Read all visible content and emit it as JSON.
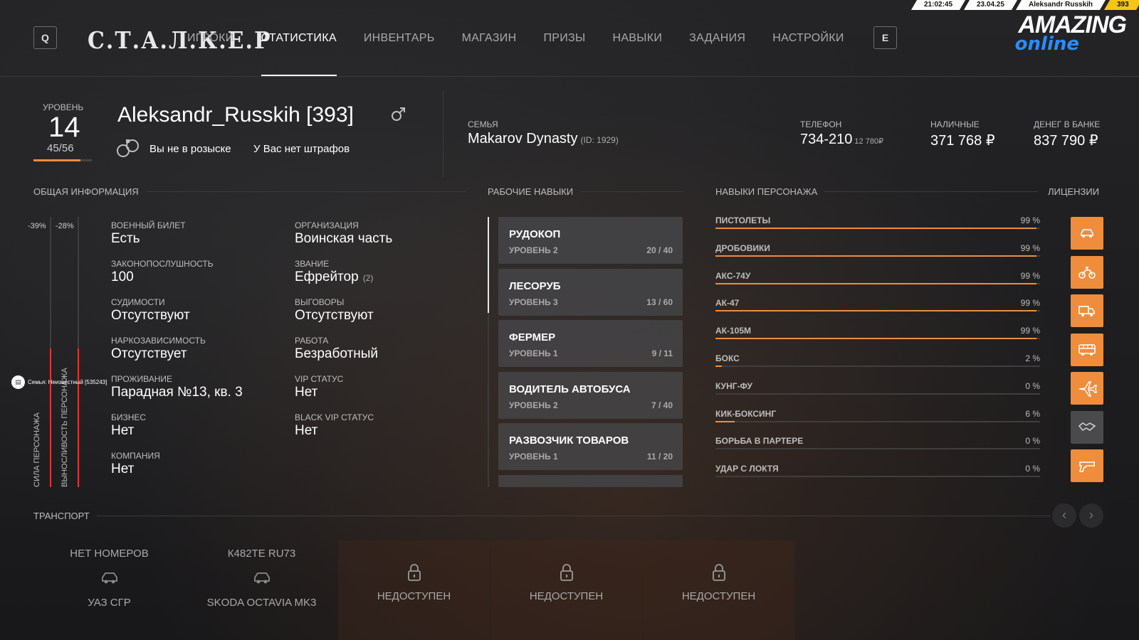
{
  "topbar": {
    "time": "21:02:45",
    "date": "23.04.25",
    "user": "Aleksandr Russkih",
    "id": "393"
  },
  "nav": {
    "left_key": "Q",
    "right_key": "E",
    "logo": "С.Т.А.Л.К.Е.Р",
    "items": [
      "ИГРОКИ",
      "СТАТИСТИКА",
      "ИНВЕНТАРЬ",
      "МАГАЗИН",
      "ПРИЗЫ",
      "НАВЫКИ",
      "ЗАДАНИЯ",
      "НАСТРОЙКИ"
    ],
    "active": "СТАТИСТИКА"
  },
  "brand": {
    "line1": "AMAZING",
    "line2": "online"
  },
  "player": {
    "level_label": "УРОВЕНЬ",
    "level": "14",
    "xp": "45/56",
    "xp_progress": 0.8,
    "name": "Aleksandr_Russkih [393]",
    "gender_icon": "male-icon",
    "wanted": "Вы не в розыске",
    "fines": "У Вас нет штрафов"
  },
  "family": {
    "label": "СЕМЬЯ",
    "name": "Makarov Dynasty",
    "id": "(ID: 1929)"
  },
  "stats": {
    "phone_label": "ТЕЛЕФОН",
    "phone": "734-210",
    "phone_balance": "12 780₽",
    "cash_label": "НАЛИЧНЫЕ",
    "cash": "371 768 ₽",
    "bank_label": "ДЕНЕГ В БАНКЕ",
    "bank": "837 790 ₽"
  },
  "sections": {
    "general": "ОБЩАЯ ИНФОРМАЦИЯ",
    "work": "РАБОЧИЕ НАВЫКИ",
    "character": "НАВЫКИ ПЕРСОНАЖА",
    "licenses": "ЛИЦЕНЗИИ",
    "transport": "ТРАНСПОРТ"
  },
  "gauges": {
    "strength_label": "СИЛА ПЕРСОНАЖА",
    "strength_pct": "-39%",
    "stamina_label": "ВЫНОСЛИВОСТЬ ПЕРСОНАЖА",
    "stamina_pct": "-28%"
  },
  "general_left": [
    {
      "label": "ВОЕННЫЙ БИЛЕТ",
      "value": "Есть"
    },
    {
      "label": "ЗАКОНОПОСЛУШНОСТЬ",
      "value": "100"
    },
    {
      "label": "СУДИМОСТИ",
      "value": "Отсутствуют"
    },
    {
      "label": "НАРКОЗАВИСИМОСТЬ",
      "value": "Отсутствует"
    },
    {
      "label": "ПРОЖИВАНИЕ",
      "value": "Парадная №13, кв. 3"
    },
    {
      "label": "БИЗНЕС",
      "value": "Нет"
    },
    {
      "label": "КОМПАНИЯ",
      "value": "Нет"
    }
  ],
  "general_right": [
    {
      "label": "ОРГАНИЗАЦИЯ",
      "value": "Воинская часть",
      "extra": ""
    },
    {
      "label": "ЗВАНИЕ",
      "value": "Ефрейтор",
      "extra": "(2)"
    },
    {
      "label": "ВЫГОВОРЫ",
      "value": "Отсутствуют",
      "extra": ""
    },
    {
      "label": "РАБОТА",
      "value": "Безработный",
      "extra": ""
    },
    {
      "label": "VIP СТАТУС",
      "value": "Нет",
      "extra": ""
    },
    {
      "label": "BLACK VIP СТАТУС",
      "value": "Нет",
      "extra": ""
    }
  ],
  "family_tag": {
    "icon": "family-icon",
    "text": "Семья: Неизвестный [535243]"
  },
  "work_skills": [
    {
      "name": "РУДОКОП",
      "level": "УРОВЕНЬ 2",
      "progress": "20 / 40"
    },
    {
      "name": "ЛЕСОРУБ",
      "level": "УРОВЕНЬ 3",
      "progress": "13 / 60"
    },
    {
      "name": "ФЕРМЕР",
      "level": "УРОВЕНЬ 1",
      "progress": "9 / 11"
    },
    {
      "name": "ВОДИТЕЛЬ АВТОБУСА",
      "level": "УРОВЕНЬ 2",
      "progress": "7 / 40"
    },
    {
      "name": "РАЗВОЗЧИК ТОВАРОВ",
      "level": "УРОВЕНЬ 1",
      "progress": "11 / 20"
    }
  ],
  "char_skills": [
    {
      "name": "ПИСТОЛЕТЫ",
      "pct": "99 %",
      "value": 99
    },
    {
      "name": "ДРОБОВИКИ",
      "pct": "99 %",
      "value": 99
    },
    {
      "name": "АКС-74У",
      "pct": "99 %",
      "value": 99
    },
    {
      "name": "АК-47",
      "pct": "99 %",
      "value": 99
    },
    {
      "name": "АК-105М",
      "pct": "99 %",
      "value": 99
    },
    {
      "name": "БОКС",
      "pct": "2 %",
      "value": 2
    },
    {
      "name": "КУНГ-ФУ",
      "pct": "0 %",
      "value": 0
    },
    {
      "name": "КИК-БОКСИНГ",
      "pct": "6 %",
      "value": 6
    },
    {
      "name": "БОРЬБА В ПАРТЕРЕ",
      "pct": "0 %",
      "value": 0
    },
    {
      "name": "УДАР С ЛОКТЯ",
      "pct": "0 %",
      "value": 0
    }
  ],
  "licenses": [
    {
      "icon": "car-icon",
      "active": true
    },
    {
      "icon": "motorcycle-icon",
      "active": true
    },
    {
      "icon": "truck-icon",
      "active": true
    },
    {
      "icon": "bus-icon",
      "active": true
    },
    {
      "icon": "plane-icon",
      "active": true
    },
    {
      "icon": "handshake-icon",
      "active": false
    },
    {
      "icon": "pistol-icon",
      "active": true
    }
  ],
  "transport": [
    {
      "plate": "НЕТ НОМЕРОВ",
      "name": "УАЗ СГР",
      "locked": false
    },
    {
      "plate": "К482ТЕ RU73",
      "name": "SKODA OCTAVIA MK3",
      "locked": false
    },
    {
      "plate": "",
      "name": "НЕДОСТУПЕН",
      "locked": true
    },
    {
      "plate": "",
      "name": "НЕДОСТУПЕН",
      "locked": true
    },
    {
      "plate": "",
      "name": "НЕДОСТУПЕН",
      "locked": true
    }
  ],
  "transport_nav": {
    "prev": "‹",
    "next": "›"
  }
}
